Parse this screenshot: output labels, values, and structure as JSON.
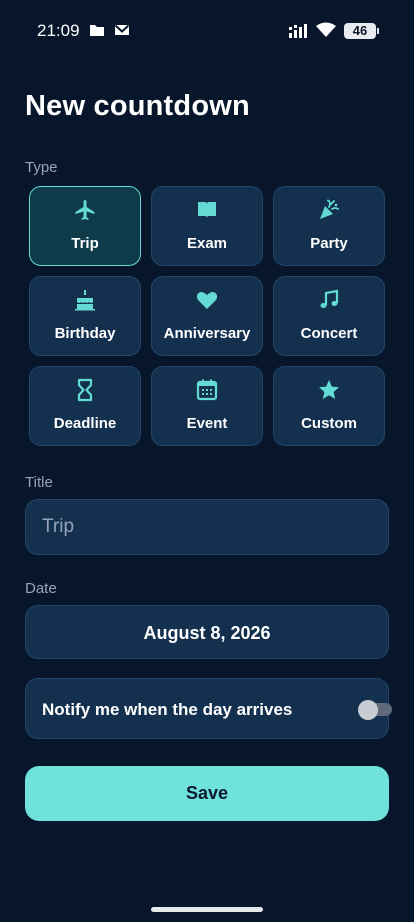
{
  "status_bar": {
    "time": "21:09",
    "battery": "46",
    "icons": [
      "folder-icon",
      "mail-icon",
      "signal-icon",
      "wifi-icon",
      "battery-icon"
    ]
  },
  "page_title": "New countdown",
  "type_section": {
    "label": "Type",
    "selected": "Trip",
    "options": [
      {
        "label": "Trip",
        "icon": "airplane-icon"
      },
      {
        "label": "Exam",
        "icon": "book-icon"
      },
      {
        "label": "Party",
        "icon": "party-popper-icon"
      },
      {
        "label": "Birthday",
        "icon": "cake-icon"
      },
      {
        "label": "Anniversary",
        "icon": "heart-icon"
      },
      {
        "label": "Concert",
        "icon": "music-note-icon"
      },
      {
        "label": "Deadline",
        "icon": "hourglass-icon"
      },
      {
        "label": "Event",
        "icon": "calendar-icon"
      },
      {
        "label": "Custom",
        "icon": "star-icon"
      }
    ]
  },
  "title_section": {
    "label": "Title",
    "value": "",
    "placeholder": "Trip"
  },
  "date_section": {
    "label": "Date",
    "value": "August 8, 2026"
  },
  "notify": {
    "label": "Notify me when the day arrives",
    "enabled": false
  },
  "save_label": "Save",
  "colors": {
    "background": "#07162b",
    "tile": "#14304f",
    "accent": "#6ee2db",
    "muted_text": "#95a4b8"
  }
}
